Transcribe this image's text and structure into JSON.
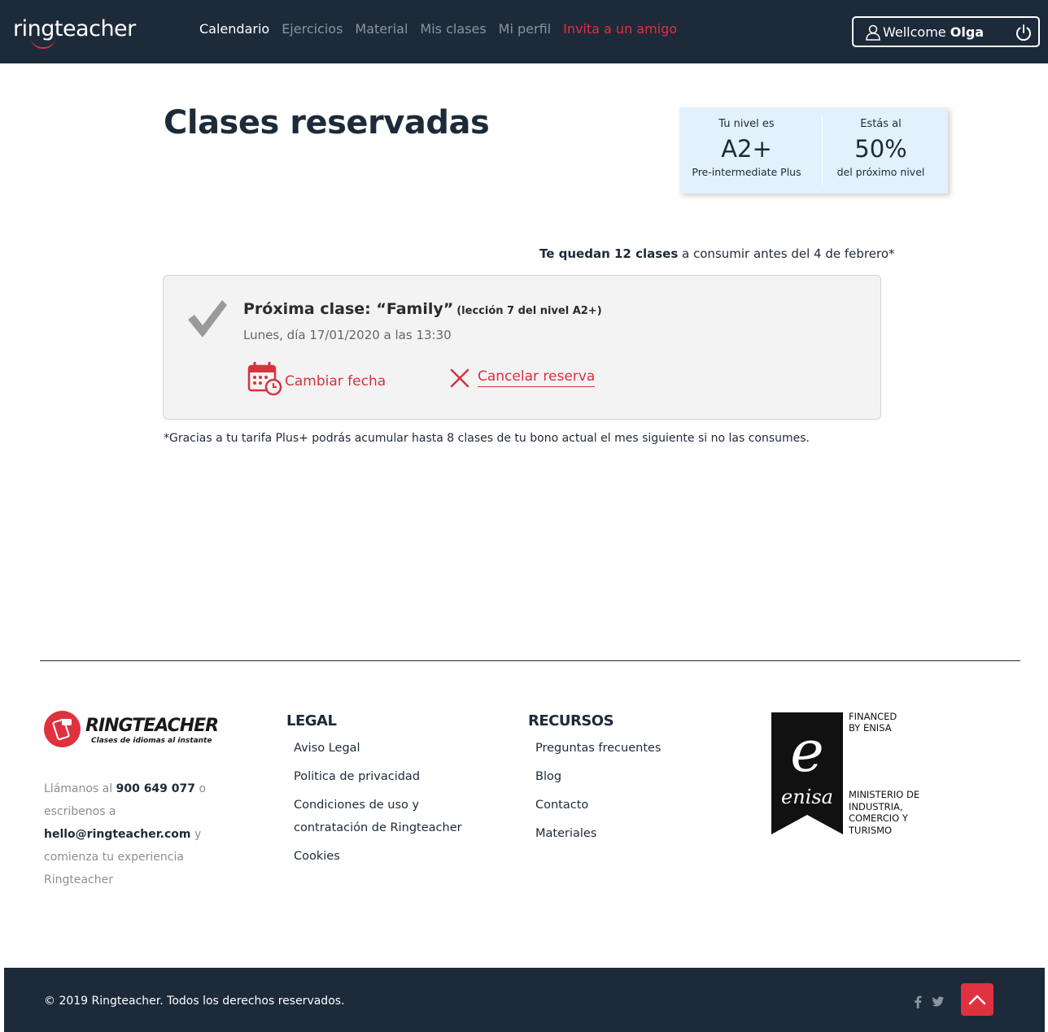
{
  "header": {
    "logo": "ringteacher",
    "nav": [
      "Calendario",
      "Ejercicios",
      "Material",
      "Mis clases",
      "Mi perfil",
      "Invita a un amigo"
    ],
    "welcome": "Wellcome",
    "user_name": "Olga"
  },
  "main": {
    "title": "Clases reservadas",
    "level": {
      "label": "Tu nivel es",
      "value": "A2+",
      "sub": "Pre-intermediate Plus"
    },
    "progress": {
      "label": "Estás al",
      "value": "50%",
      "sub": "del próximo nivel"
    },
    "remaining_bold": "Te quedan 12 clases",
    "remaining_rest": " a consumir antes del 4 de febrero*",
    "next_class": {
      "title": "Próxima clase: “Family”",
      "lesson": "(lección 7 del nivel A2+)",
      "date": "Lunes, día 17/01/2020 a las 13:30",
      "change_label": "Cambiar fecha",
      "cancel_label": "Cancelar reserva"
    },
    "note": "*Gracias a tu tarifa Plus+ podrás acumular hasta 8 clases de tu bono actual el mes siguiente si no las consumes."
  },
  "footer": {
    "brand_name": "RINGTEACHER",
    "brand_tagline": "Clases de idiomas al instante",
    "contact": {
      "call": "Llámanos al ",
      "phone": "900 649 077",
      "or_write": " o escribenos a ",
      "email": "hello@ringteacher.com",
      "tail": " y comienza tu experiencia Ringteacher"
    },
    "legal_heading": "LEGAL",
    "legal_links": [
      "Aviso Legal",
      "Politica de privacidad",
      "Condiciones de uso y contratación de Ringteacher",
      "Cookies"
    ],
    "resources_heading": "RECURSOS",
    "resources_links": [
      "Preguntas frecuentes",
      "Blog",
      "Contacto",
      "Materiales"
    ],
    "enisa_financed": "FINANCED BY ENISA",
    "enisa_logo": "enisa",
    "enisa_ministry": "MINISTERIO DE INDUSTRIA, COMERCIO Y TURISMO",
    "copyright": "© 2019 Ringteacher. Todos los derechos reservados."
  }
}
